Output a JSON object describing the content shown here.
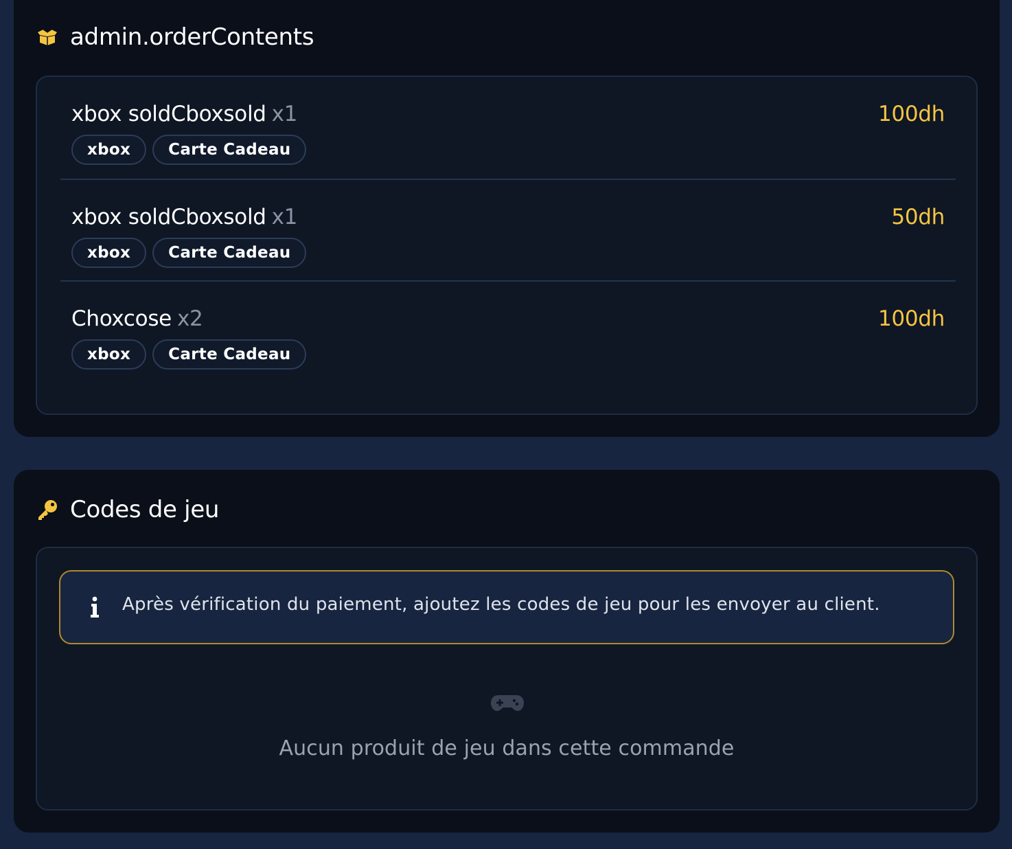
{
  "colors": {
    "accent": "#f5c542",
    "background": "#172540",
    "card": "#0a0f1a"
  },
  "order_contents": {
    "icon": "box-open-icon",
    "title": "admin.orderContents",
    "items": [
      {
        "name": "xbox soldCboxsold",
        "qty": "x1",
        "price": "100dh",
        "tags": [
          "xbox",
          "Carte Cadeau"
        ]
      },
      {
        "name": "xbox soldCboxsold",
        "qty": "x1",
        "price": "50dh",
        "tags": [
          "xbox",
          "Carte Cadeau"
        ]
      },
      {
        "name": "Choxcose",
        "qty": "x2",
        "price": "100dh",
        "tags": [
          "xbox",
          "Carte Cadeau"
        ]
      }
    ]
  },
  "game_codes": {
    "icon": "key-icon",
    "title": "Codes de jeu",
    "notice_icon": "info-icon",
    "notice": "Après vérification du paiement, ajoutez les codes de jeu pour les envoyer au client.",
    "empty_icon": "gamepad-icon",
    "empty_text": "Aucun produit de jeu dans cette commande"
  }
}
